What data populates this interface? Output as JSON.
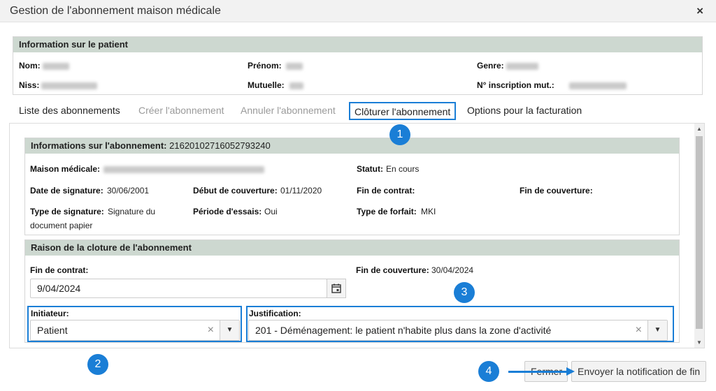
{
  "window": {
    "title": "Gestion de l'abonnement maison médicale",
    "close_icon": "×"
  },
  "patient": {
    "header": "Information sur le patient",
    "nom_label": "Nom:",
    "prenom_label": "Prénom:",
    "genre_label": "Genre:",
    "niss_label": "Niss:",
    "mutuelle_label": "Mutuelle:",
    "inscription_label": "N° inscription mut.:"
  },
  "tabs": [
    {
      "label": "Liste des abonnements",
      "state": "normal"
    },
    {
      "label": "Créer l'abonnement",
      "state": "disabled"
    },
    {
      "label": "Annuler l'abonnement",
      "state": "disabled"
    },
    {
      "label": "Clôturer l'abonnement",
      "state": "active"
    },
    {
      "label": "Options pour la facturation",
      "state": "normal"
    }
  ],
  "subscription": {
    "header_label": "Informations sur l'abonnement:",
    "header_id": "21620102716052793240",
    "maison_label": "Maison médicale:",
    "statut_label": "Statut:",
    "statut_value": "En cours",
    "date_signature_label": "Date de signature:",
    "date_signature_value": "30/06/2001",
    "debut_label": "Début de couverture:",
    "debut_value": "01/11/2020",
    "fin_contrat_label": "Fin de contrat:",
    "fin_couverture_label": "Fin de couverture:",
    "type_signature_label": "Type de signature:",
    "type_signature_value_1": "Signature du",
    "type_signature_value_2": "document papier",
    "periode_label": "Période d'essais:",
    "periode_value": "Oui",
    "type_forfait_label": "Type de forfait:",
    "type_forfait_value": "MKI"
  },
  "closure": {
    "header": "Raison de la cloture de l'abonnement",
    "fin_contrat_label": "Fin de contrat:",
    "fin_contrat_value": "9/04/2024",
    "fin_couverture_label": "Fin de couverture:",
    "fin_couverture_value": "30/04/2024",
    "initiateur_label": "Initiateur:",
    "initiateur_value": "Patient",
    "justification_label": "Justification:",
    "justification_value": "201 - Déménagement: le patient n'habite plus dans la zone d'activité",
    "clear_icon": "×",
    "dropdown_icon": "▼"
  },
  "annotations": [
    "1",
    "2",
    "3",
    "4"
  ],
  "footer": {
    "fermer_label": "Fermer",
    "send_label": "Envoyer la notification de fin"
  },
  "colors": {
    "accent": "#1a7ed6",
    "header_bg": "#cdd8d0"
  }
}
